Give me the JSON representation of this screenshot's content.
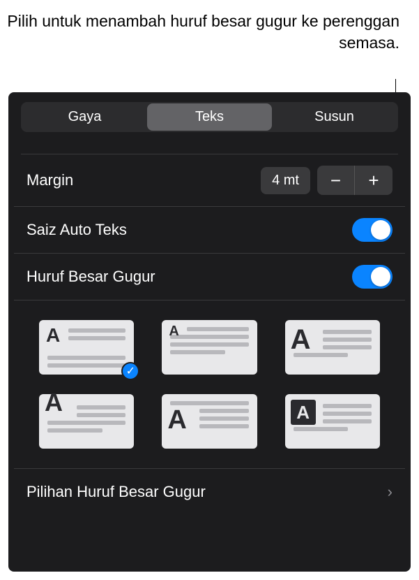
{
  "callout": "Pilih untuk menambah huruf besar gugur ke perenggan semasa.",
  "tabs": {
    "gaya": "Gaya",
    "teks": "Teks",
    "susun": "Susun",
    "active": "teks"
  },
  "margin": {
    "label": "Margin",
    "value": "4 mt"
  },
  "autoSize": {
    "label": "Saiz Auto Teks",
    "enabled": true
  },
  "dropCap": {
    "label": "Huruf Besar Gugur",
    "enabled": true,
    "optionsLabel": "Pilihan Huruf Besar Gugur",
    "selectedIndex": 0,
    "glyph": "A"
  }
}
